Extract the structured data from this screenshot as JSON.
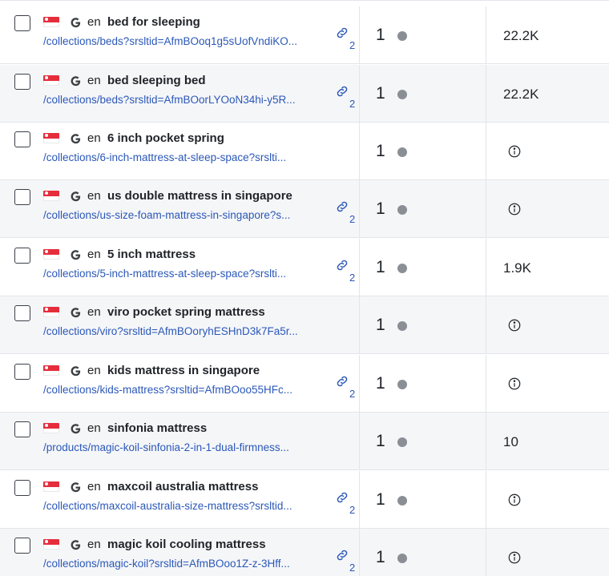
{
  "colors": {
    "link": "#2b58b8",
    "row_shade": "#f5f6f8",
    "flag_red": "#e52d3b",
    "dot": "#8a8f96"
  },
  "rows": [
    {
      "language": "en",
      "keyword": "bed for sleeping",
      "url": "/collections/beds?srsltid=AfmBOoq1g5sUofVndiKO...",
      "link_count": "2",
      "position": "1",
      "volume": "22.2K"
    },
    {
      "language": "en",
      "keyword": "bed sleeping bed",
      "url": "/collections/beds?srsltid=AfmBOorLYOoN34hi-y5R...",
      "link_count": "2",
      "position": "1",
      "volume": "22.2K"
    },
    {
      "language": "en",
      "keyword": "6 inch pocket spring",
      "url": "/collections/6-inch-mattress-at-sleep-space?srslti...",
      "link_count": "",
      "position": "1",
      "volume": ""
    },
    {
      "language": "en",
      "keyword": "us double mattress in singapore",
      "url": "/collections/us-size-foam-mattress-in-singapore?s...",
      "link_count": "2",
      "position": "1",
      "volume": ""
    },
    {
      "language": "en",
      "keyword": "5 inch mattress",
      "url": "/collections/5-inch-mattress-at-sleep-space?srslti...",
      "link_count": "2",
      "position": "1",
      "volume": "1.9K"
    },
    {
      "language": "en",
      "keyword": "viro pocket spring mattress",
      "url": "/collections/viro?srsltid=AfmBOoryhESHnD3k7Fa5r...",
      "link_count": "",
      "position": "1",
      "volume": ""
    },
    {
      "language": "en",
      "keyword": "kids mattress in singapore",
      "url": "/collections/kids-mattress?srsltid=AfmBOoo55HFc...",
      "link_count": "2",
      "position": "1",
      "volume": ""
    },
    {
      "language": "en",
      "keyword": "sinfonia mattress",
      "url": "/products/magic-koil-sinfonia-2-in-1-dual-firmness...",
      "link_count": "",
      "position": "1",
      "volume": "10"
    },
    {
      "language": "en",
      "keyword": "maxcoil australia mattress",
      "url": "/collections/maxcoil-australia-size-mattress?srsltid...",
      "link_count": "2",
      "position": "1",
      "volume": ""
    },
    {
      "language": "en",
      "keyword": "magic koil cooling mattress",
      "url": "/collections/magic-koil?srsltid=AfmBOoo1Z-z-3Hff...",
      "link_count": "2",
      "position": "1",
      "volume": ""
    }
  ]
}
